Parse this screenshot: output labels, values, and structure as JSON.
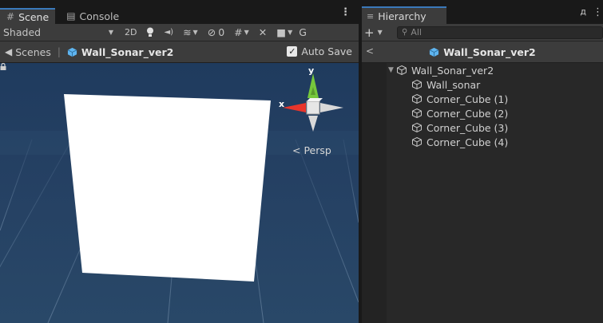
{
  "scene_tabs": [
    {
      "label": "Scene",
      "icon": "hash-grid-icon",
      "active": true
    },
    {
      "label": "Console",
      "icon": "console-icon",
      "active": false
    }
  ],
  "toolbar": {
    "shading_mode": "Shaded",
    "mode_2d": "2D",
    "hidden_count": "0",
    "trailing": "G"
  },
  "breadcrumb": {
    "scenes_label": "Scenes",
    "current": "Wall_Sonar_ver2",
    "auto_save": "Auto Save",
    "auto_save_checked": true
  },
  "viewport": {
    "projection": "Persp",
    "axis_y": "y",
    "axis_x": "x",
    "background_color": "#234262",
    "plane_color": "#ffffff"
  },
  "hierarchy": {
    "tab_label": "Hierarchy",
    "search_placeholder": "All",
    "title": "Wall_Sonar_ver2",
    "root": "Wall_Sonar_ver2",
    "children": [
      "Wall_sonar",
      "Corner_Cube (1)",
      "Corner_Cube (2)",
      "Corner_Cube (3)",
      "Corner_Cube (4)"
    ]
  },
  "colors": {
    "accent": "#3a79bb",
    "prefab_blue": "#5fb5f0",
    "gizmo_x": "#e8352b",
    "gizmo_y": "#76c83c"
  }
}
